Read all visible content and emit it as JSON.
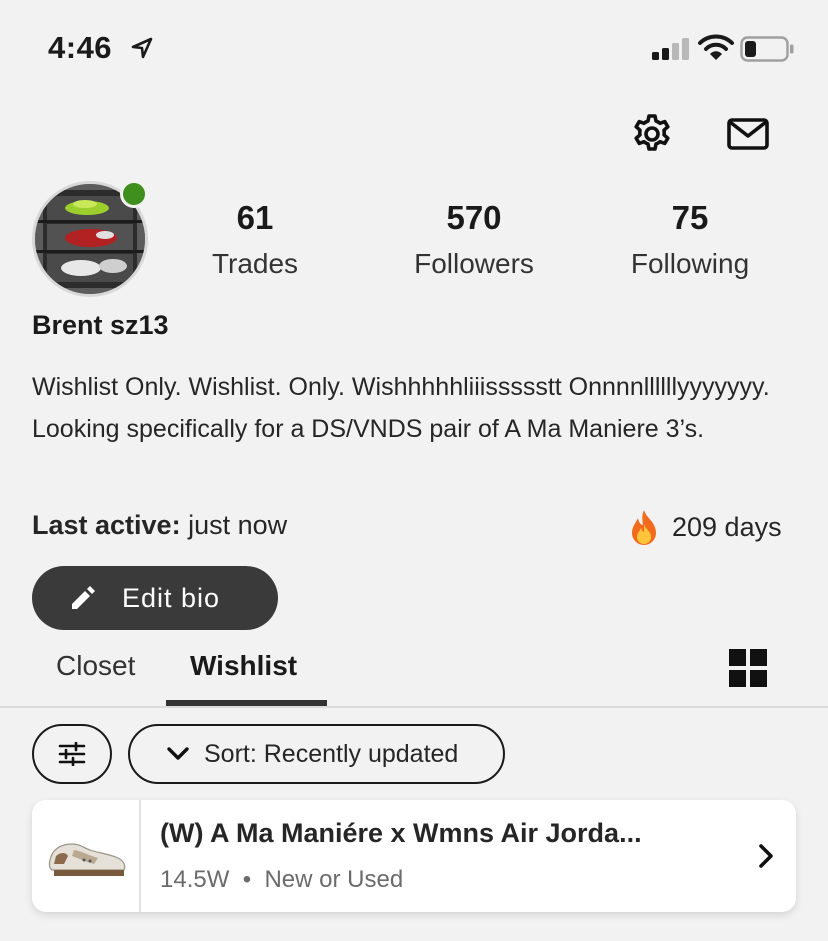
{
  "status_bar": {
    "time": "4:46"
  },
  "profile": {
    "username": "Brent sz13",
    "online": true,
    "stats": [
      {
        "value": "61",
        "label": "Trades"
      },
      {
        "value": "570",
        "label": "Followers"
      },
      {
        "value": "75",
        "label": "Following"
      }
    ],
    "bio": "Wishlist Only. Wishlist. Only.  Wishhhhhliiissssstt Onnnnllllllyyyyyyy. Looking specifically for a DS/VNDS pair of A Ma Maniere 3’s.",
    "last_active_label": "Last active:",
    "last_active_value": "just now",
    "streak": "209 days",
    "edit_bio_label": "Edit bio"
  },
  "tabs": [
    {
      "label": "Closet",
      "active": false
    },
    {
      "label": "Wishlist",
      "active": true
    }
  ],
  "filters": {
    "sort_label": "Sort: Recently updated"
  },
  "items": [
    {
      "title": "(W) A Ma Maniére x Wmns Air Jorda...",
      "size": "14.5W",
      "separator": "•",
      "condition": "New or Used"
    }
  ],
  "icons": {
    "location": "location-arrow-icon",
    "signal": "cellular-signal-icon",
    "wifi": "wifi-icon",
    "battery": "battery-icon",
    "settings": "gear-icon",
    "messages": "mail-icon",
    "edit": "pencil-icon",
    "streak": "fire-icon",
    "view": "grid-icon",
    "filter": "sliders-icon",
    "sort": "chevron-down-icon",
    "item_open": "chevron-right-icon"
  },
  "colors": {
    "online": "#3f8f1c",
    "button_dark": "#3a3a3a",
    "background": "#f2f2f2"
  }
}
